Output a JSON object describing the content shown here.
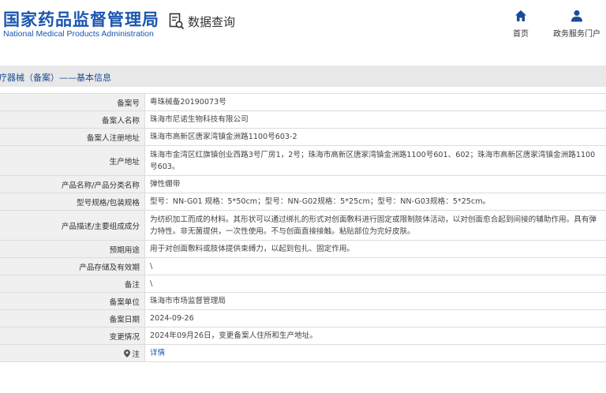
{
  "header": {
    "logo_cn": "国家药品监督管理局",
    "logo_en": "National Medical Products Administration",
    "query_label": "数据查询",
    "nav": [
      {
        "label": "首页",
        "icon": "home-icon"
      },
      {
        "label": "政务服务门户",
        "icon": "user-icon"
      }
    ]
  },
  "breadcrumb": "疗器械（备案）——基本信息",
  "rows": [
    {
      "label": "备案号",
      "value": "粤珠械备20190073号"
    },
    {
      "label": "备案人名称",
      "value": "珠海市尼诺生物科技有限公司"
    },
    {
      "label": "备案人注册地址",
      "value": "珠海市高新区唐家湾镇金洲路1100号603-2"
    },
    {
      "label": "生产地址",
      "value": "珠海市金湾区红旗镇创业西路3号厂房1，2号；珠海市高新区唐家湾镇金洲路1100号601、602；珠海市高新区唐家湾镇金洲路1100号603。"
    },
    {
      "label": "产品名称/产品分类名称",
      "value": "弹性绷带"
    },
    {
      "label": "型号规格/包装规格",
      "value": "型号：NN-G01 规格：5*50cm；型号：NN-G02规格：5*25cm；型号：NN-G03规格：5*25cm。"
    },
    {
      "label": "产品描述/主要组成成分",
      "value": "为纺织加工而成的材料。其形状可以通过绑扎的形式对创面敷料进行固定或限制肢体活动，以对创面愈合起到间接的辅助作用。具有弹力特性。非无菌提供，一次性使用。不与创面直接接触。粘贴部位为完好皮肤。"
    },
    {
      "label": "预期用途",
      "value": "用于对创面敷料或肢体提供束缚力，以起到包扎、固定作用。"
    },
    {
      "label": "产品存储及有效期",
      "value": "\\"
    },
    {
      "label": "备注",
      "value": "\\"
    },
    {
      "label": "备案单位",
      "value": "珠海市市场监督管理局"
    },
    {
      "label": "备案日期",
      "value": "2024-09-26"
    },
    {
      "label": "变更情况",
      "value": "2024年09月26日，变更备案人住所和生产地址。"
    },
    {
      "label": "注",
      "value": "详情"
    }
  ]
}
